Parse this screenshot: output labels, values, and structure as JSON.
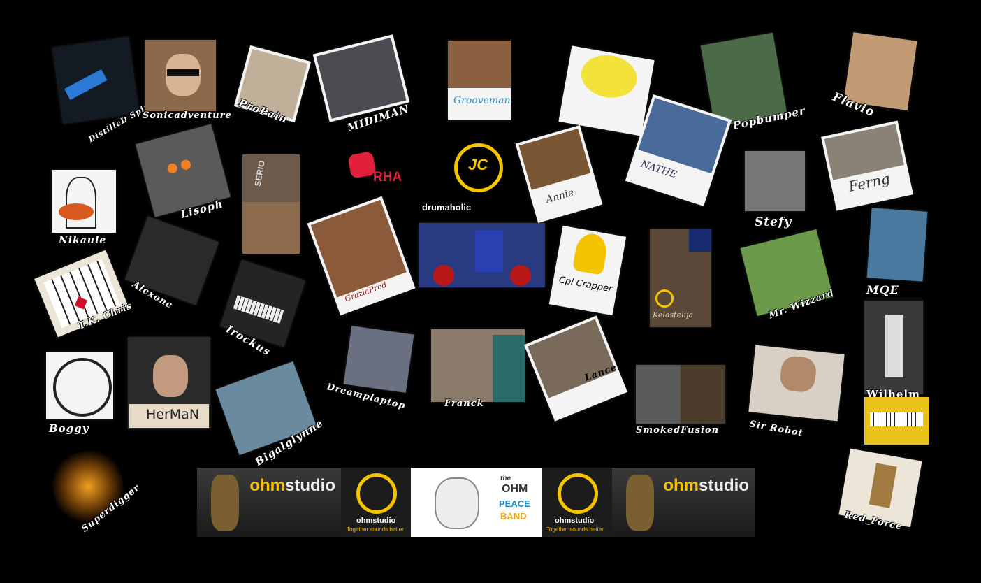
{
  "members": {
    "distilled": "DistilleD Spirits",
    "sonicadventure": "Sonicadventure",
    "propain": "ProPain",
    "midiman": "MIDIMAN",
    "grooveman_sig": "Grooveman",
    "flavio": "Flavio",
    "popbumper": "Popbumper",
    "nikaule": "Nikaule",
    "lisoph": "Lisoph",
    "serio": "SERIO",
    "rha": "RHA",
    "jc": "JC",
    "drumaholic": "drumaholic",
    "annie_sig": "Annie",
    "nathe_sig": "NATHE",
    "stefy": "Stefy",
    "ferng_sig": "Ferng",
    "mqe": "MQE",
    "alexone": "Alexone",
    "tkchris": "T.K. Chris",
    "irockus": "Irockus",
    "grazia_sig": "GraziaProd",
    "cpl_crapper": "Cpl Crapper",
    "kelastalija_sig": "Kelastelija",
    "mr_wizzard": "Mr. Wizzard",
    "boggy": "Boggy",
    "herman": "HerMaN",
    "bigalglynne": "Bigalglynne",
    "dreamplaptop": "Dreamplaptop",
    "franck": "Franck",
    "lance": "Lance",
    "smokedfusion": "SmokedFusion",
    "sir_robot": "Sir Robot",
    "wilhelm": "Wilhelm",
    "superdigger": "Superdigger",
    "red_force": "Red_Force"
  },
  "banner": {
    "ohm_a": "ohm",
    "studio_a": "studio",
    "ohmstudio_small": "ohmstudio",
    "tagline": "Together sounds better",
    "the": "the",
    "peace_line1": "OHM",
    "peace_line2": "PEACE",
    "peace_line3": "BAND"
  },
  "colors": {
    "background": "#000000",
    "ohm_yellow": "#f5c400",
    "rha_red": "#e0203a"
  }
}
